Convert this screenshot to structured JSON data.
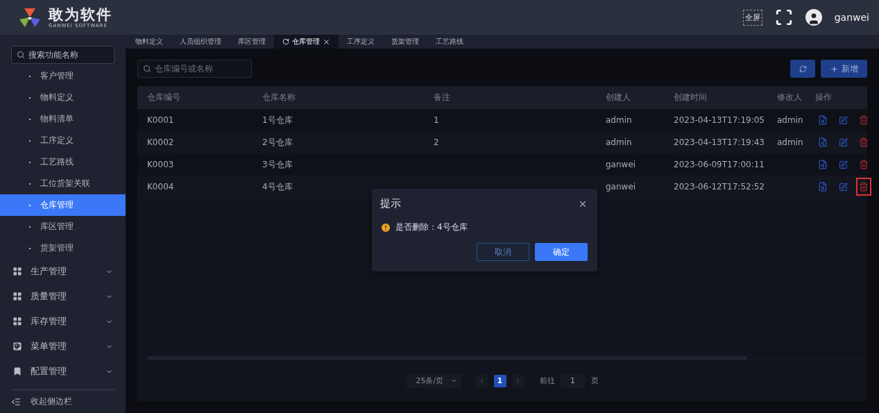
{
  "header": {
    "brand": "敢为软件",
    "brand_sub": "GANWEI SOFTWARE",
    "fullscreen_label": "全屏",
    "user": "ganwei"
  },
  "sidebar": {
    "search": {
      "placeholder": "搜索功能名称"
    },
    "items": [
      {
        "label": "客户管理",
        "kind": "sub",
        "selected": false
      },
      {
        "label": "物料定义",
        "kind": "sub",
        "selected": false
      },
      {
        "label": "物料清单",
        "kind": "sub",
        "selected": false
      },
      {
        "label": "工序定义",
        "kind": "sub",
        "selected": false
      },
      {
        "label": "工艺路线",
        "kind": "sub",
        "selected": false
      },
      {
        "label": "工位货架关联",
        "kind": "sub",
        "selected": false
      },
      {
        "label": "仓库管理",
        "kind": "sub",
        "selected": true
      },
      {
        "label": "库区管理",
        "kind": "sub",
        "selected": false
      },
      {
        "label": "货架管理",
        "kind": "sub",
        "selected": false
      },
      {
        "label": "生产管理",
        "kind": "group",
        "expanded": false
      },
      {
        "label": "质量管理",
        "kind": "group",
        "expanded": false
      },
      {
        "label": "库存管理",
        "kind": "group",
        "expanded": false
      },
      {
        "label": "菜单管理",
        "kind": "group",
        "expanded": false
      },
      {
        "label": "配置管理",
        "kind": "group",
        "expanded": false
      }
    ],
    "collapse_label": "收起侧边栏"
  },
  "tabs": [
    {
      "label": "物料定义",
      "selected": false
    },
    {
      "label": "人员组织管理",
      "selected": false
    },
    {
      "label": "库区管理",
      "selected": false
    },
    {
      "label": "仓库管理",
      "selected": true
    },
    {
      "label": "工序定义",
      "selected": false
    },
    {
      "label": "货架管理",
      "selected": false
    },
    {
      "label": "工艺路线",
      "selected": false
    }
  ],
  "toolbar": {
    "search": {
      "placeholder": "仓库编号或名称"
    },
    "add_label": "新增"
  },
  "table": {
    "columns": [
      "仓库编号",
      "仓库名称",
      "备注",
      "创建人",
      "创建时间",
      "修改人",
      "操作"
    ],
    "rows": [
      {
        "code": "K0001",
        "name": "1号仓库",
        "note": "1",
        "creator": "admin",
        "created": "2023-04-13T17:19:05",
        "modifier": "admin",
        "delete_highlighted": false
      },
      {
        "code": "K0002",
        "name": "2号仓库",
        "note": "2",
        "creator": "admin",
        "created": "2023-04-13T17:19:43",
        "modifier": "admin",
        "delete_highlighted": false
      },
      {
        "code": "K0003",
        "name": "3号仓库",
        "creator": "ganwei",
        "created": "2023-06-09T17:00:11",
        "delete_highlighted": false
      },
      {
        "code": "K0004",
        "name": "4号仓库",
        "creator": "ganwei",
        "created": "2023-06-12T17:52:52",
        "delete_highlighted": true
      }
    ]
  },
  "pagination": {
    "page_size": "25条/页",
    "pages": [
      {
        "label": "1",
        "selected": true
      }
    ],
    "goto_label": "前往",
    "goto_value": "1",
    "page_unit": "页"
  },
  "dialog": {
    "title": "提示",
    "message": "是否删除：4号仓库",
    "cancel": "取消",
    "confirm": "确定"
  }
}
